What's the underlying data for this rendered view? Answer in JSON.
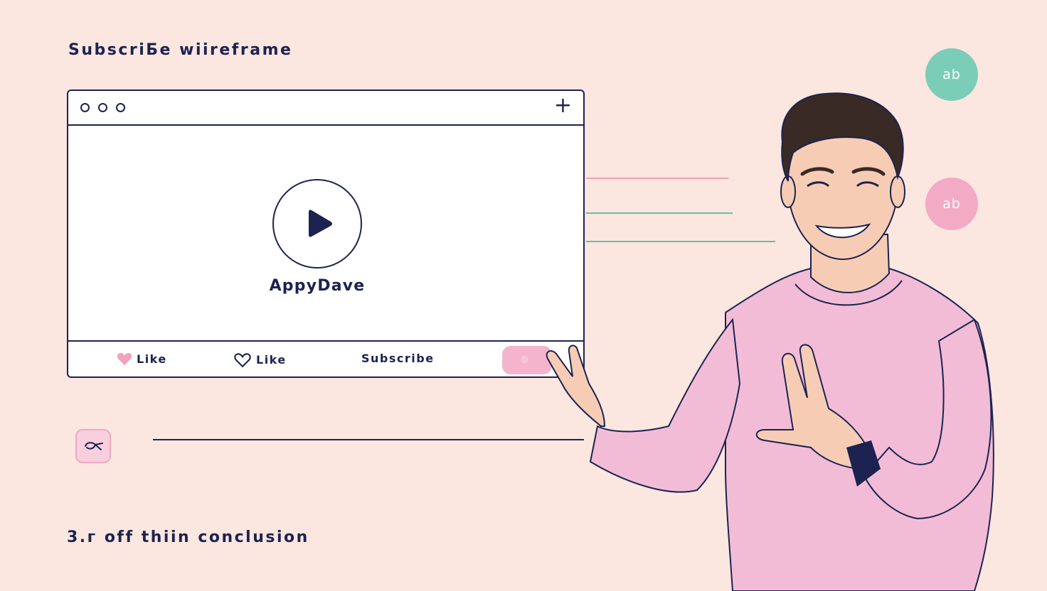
{
  "heading": "SubscriБe wiireframe",
  "footer_text": "3.г off thiin conclusion",
  "window": {
    "channel_name": "AppyDave",
    "actions": {
      "like_filled": "Like",
      "like_outline": "Like",
      "subscribe": "Subscribe"
    },
    "icons": [
      "window-dots",
      "plus-icon",
      "play-icon",
      "heart-filled-icon",
      "heart-outline-icon"
    ]
  },
  "badges": {
    "top": "ab",
    "bottom": "ab"
  },
  "colors": {
    "background": "#fbe6e0",
    "navy": "#1c2350",
    "teal": "#7ccdb8",
    "pink": "#f3aac4",
    "line_pink": "#ef9fb4",
    "line_teal": "#5cc2a4"
  }
}
